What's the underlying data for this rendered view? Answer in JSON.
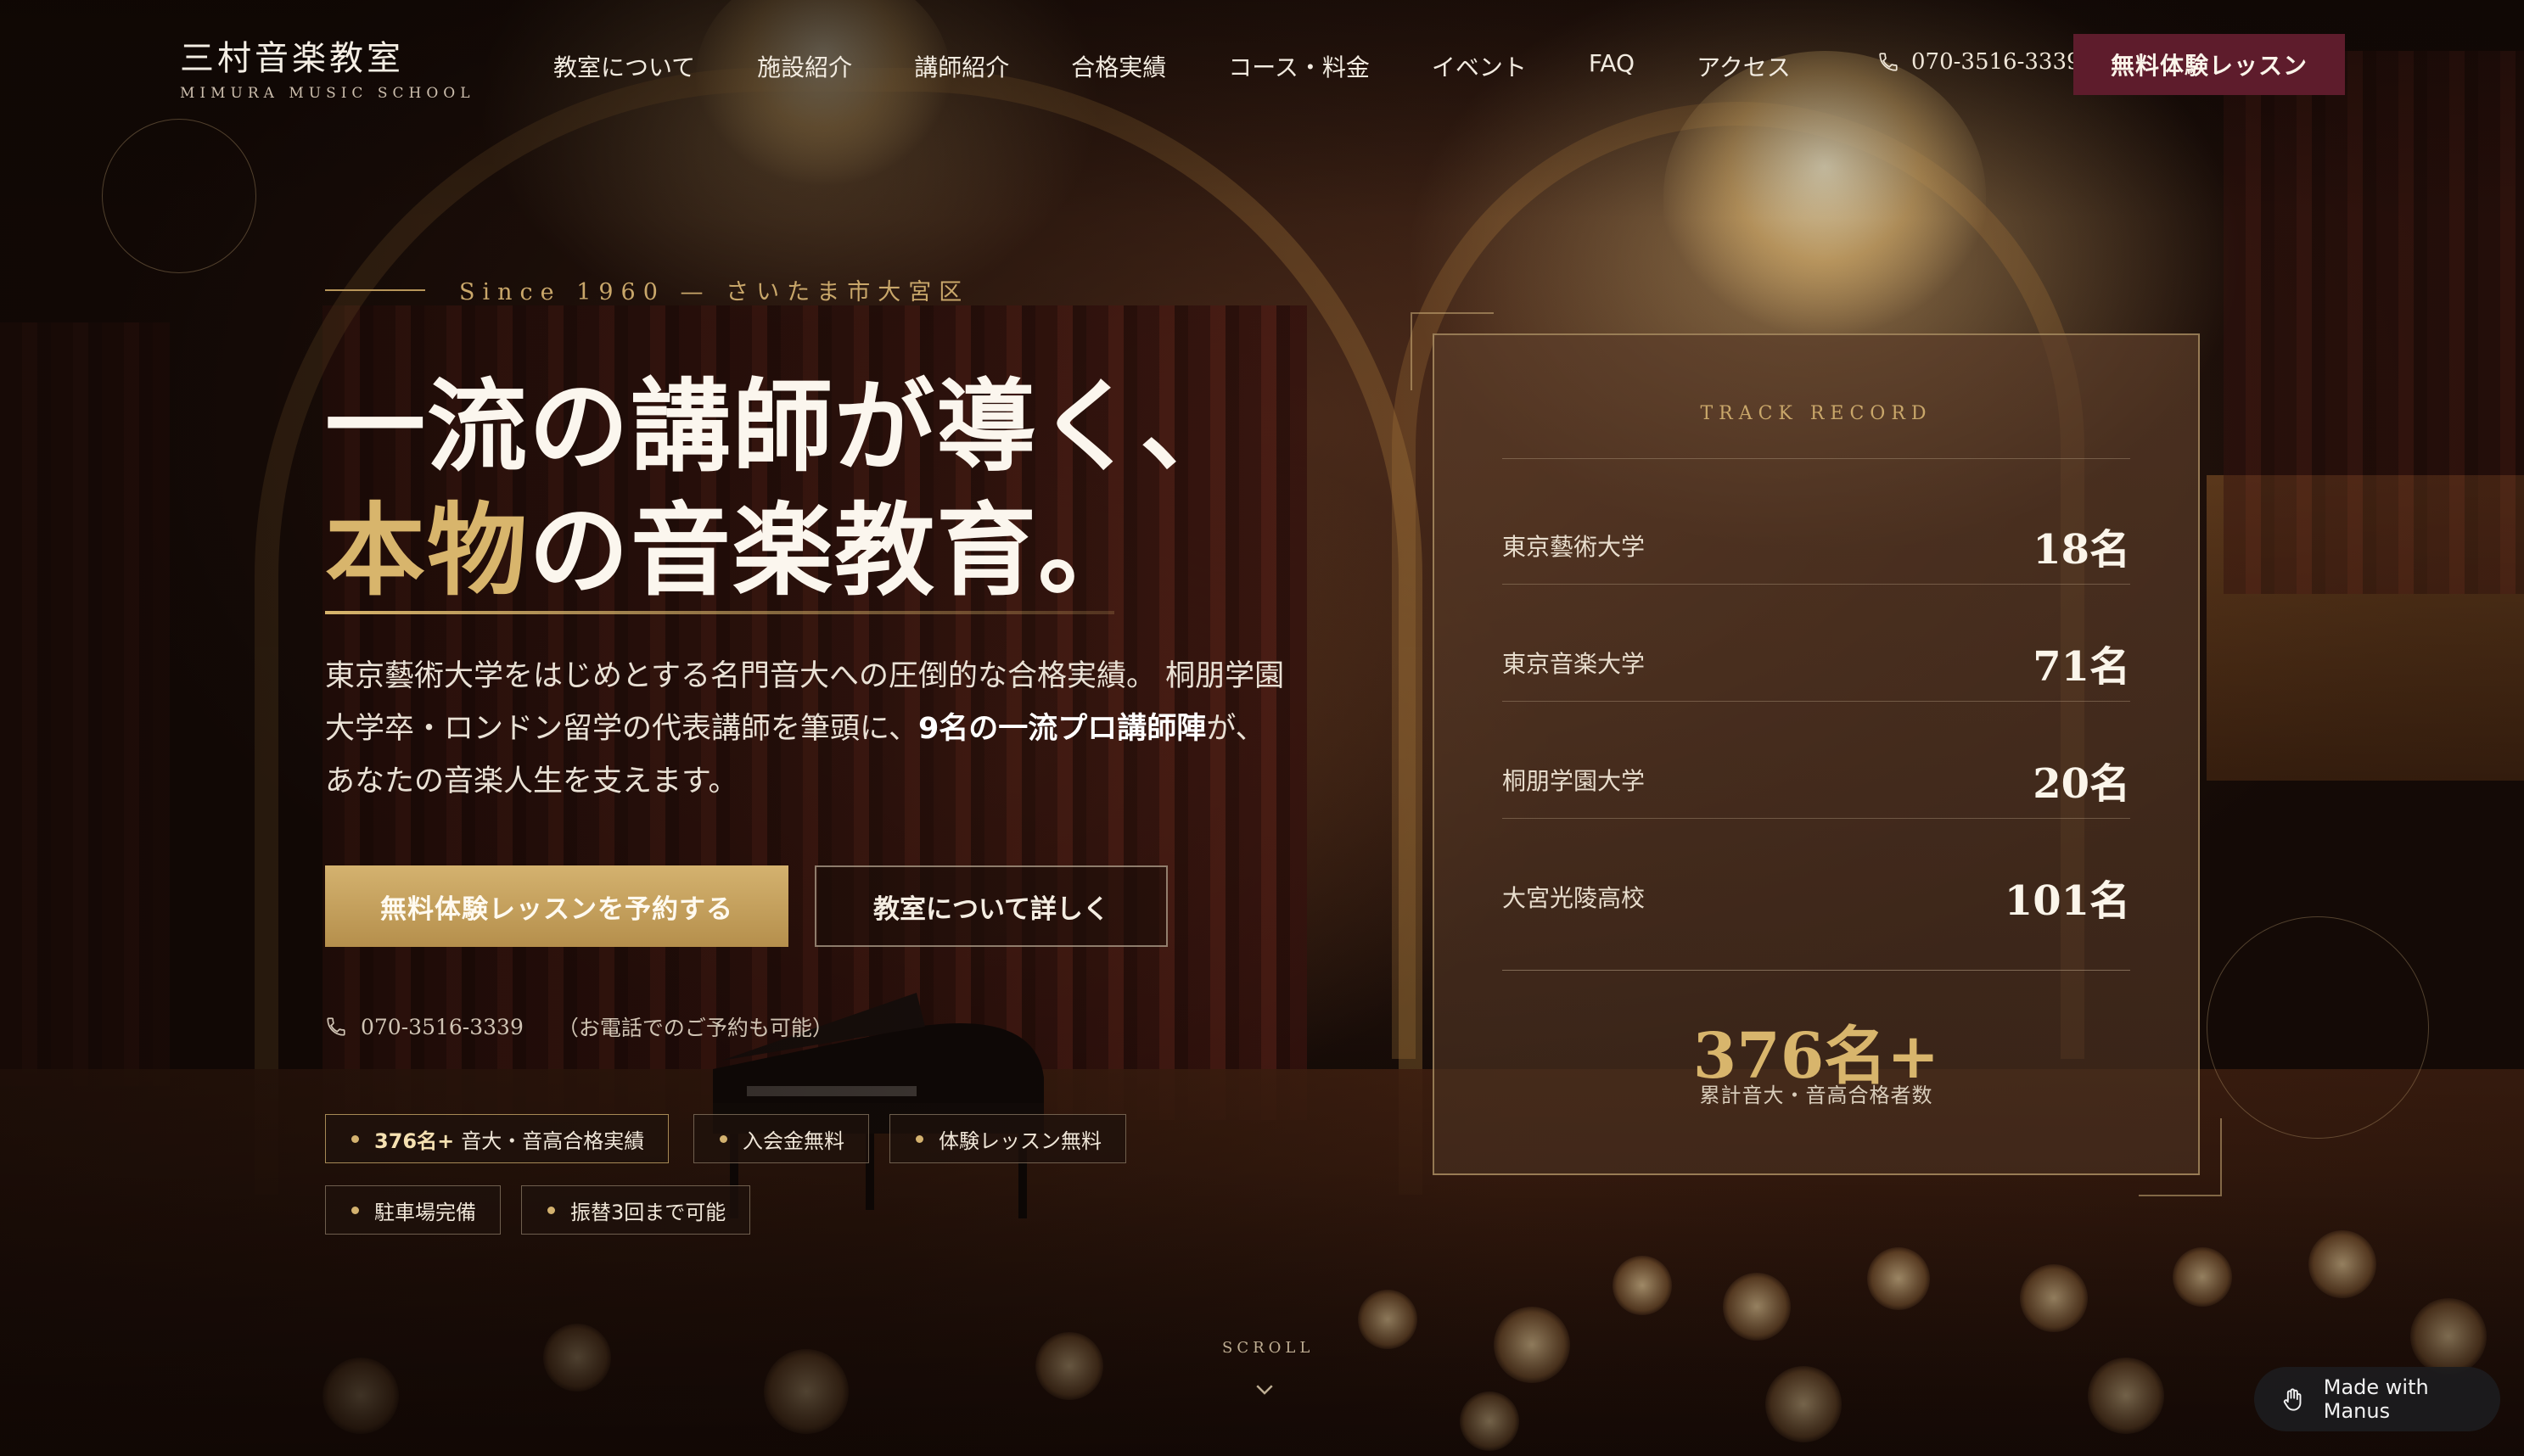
{
  "logo": {
    "jp": "三村音楽教室",
    "en": "MIMURA MUSIC SCHOOL"
  },
  "nav": {
    "items": [
      "教室について",
      "施設紹介",
      "講師紹介",
      "合格実績",
      "コース・料金",
      "イベント",
      "FAQ",
      "アクセス"
    ]
  },
  "header": {
    "phone": "070-3516-3339",
    "cta": "無料体験レッスン"
  },
  "hero": {
    "since": "Since 1960 — さいたま市大宮区",
    "title_line1": "一流の講師が導く、",
    "title_line2_gold": "本物",
    "title_line2_rest": "の音楽教育。",
    "desc_part1": "東京藝術大学をはじめとする名門音大への圧倒的な合格実績。 桐朋学園大学卒・ロンドン留学の代表講師を筆頭に、",
    "desc_bold": "9名の一流プロ講師陣",
    "desc_part2": "が、あなたの音楽人生を支えます。",
    "btn_primary": "無料体験レッスンを予約する",
    "btn_secondary": "教室について詳しく",
    "phone": "070-3516-3339",
    "phone_note": "（お電話でのご予約も可能）",
    "badges": [
      {
        "strong": "376名+",
        "text": "音大・音高合格実績"
      },
      {
        "strong": "",
        "text": "入会金無料"
      },
      {
        "strong": "",
        "text": "体験レッスン無料"
      },
      {
        "strong": "",
        "text": "駐車場完備"
      },
      {
        "strong": "",
        "text": "振替3回まで可能"
      }
    ]
  },
  "track_record": {
    "label": "TRACK RECORD",
    "rows": [
      {
        "school": "東京藝術大学",
        "count": "18名"
      },
      {
        "school": "東京音楽大学",
        "count": "71名"
      },
      {
        "school": "桐朋学園大学",
        "count": "20名"
      },
      {
        "school": "大宮光陵高校",
        "count": "101名"
      }
    ],
    "total_value": "376名+",
    "total_label": "累計音大・音高合格者数"
  },
  "scroll": {
    "label": "SCROLL"
  },
  "badge_made": {
    "text": "Made with Manus"
  },
  "colors": {
    "gold": "#d8b56c",
    "burgundy": "#5e1c2c",
    "panel_border": "#d7b982"
  },
  "icons": [
    "phone-icon",
    "chevron-down-icon",
    "manus-hand-icon"
  ]
}
